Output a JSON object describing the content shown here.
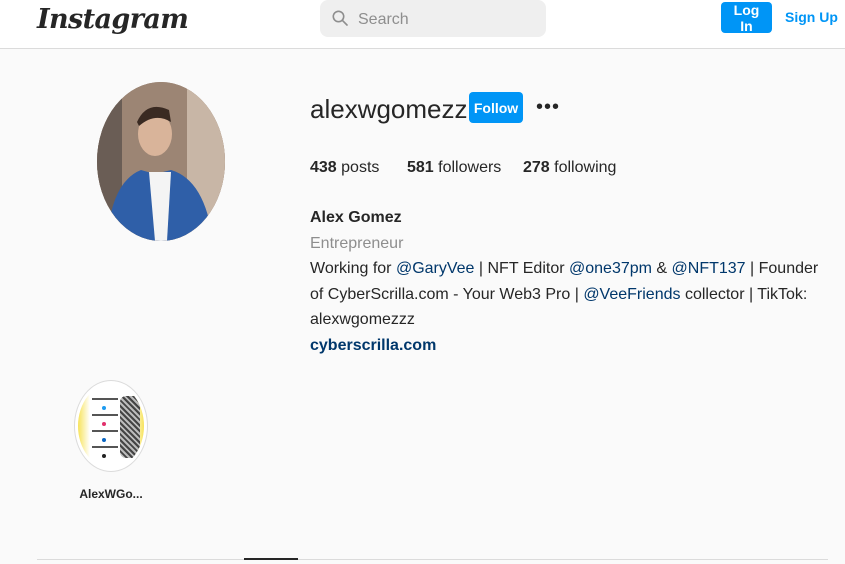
{
  "nav": {
    "logo": "Instagram",
    "search_placeholder": "Search",
    "login_label": "Log In",
    "signup_label": "Sign Up"
  },
  "profile": {
    "username": "alexwgomezz",
    "follow_label": "Follow",
    "more_label": "•••",
    "stats": {
      "posts_count": "438",
      "posts_label": "posts",
      "followers_count": "581",
      "followers_label": "followers",
      "following_count": "278",
      "following_label": "following"
    },
    "full_name": "Alex Gomez",
    "category": "Entrepreneur",
    "bio": {
      "t1": "Working for ",
      "m1": "@GaryVee",
      "t2": " | NFT Editor ",
      "m2": "@one37pm",
      "t3": " & ",
      "m3": "@NFT137",
      "t4": " | Founder of CyberScrilla.com - Your Web3 Pro | ",
      "m4": "@VeeFriends",
      "t5": " collector | TikTok: alexwgomezzz"
    },
    "website": "cyberscrilla.com"
  },
  "highlights": [
    {
      "label": "AlexWGo..."
    }
  ],
  "colors": {
    "accent": "#0095f6",
    "mention": "#00376b",
    "muted": "#8e8e8e",
    "border": "#dbdbdb"
  }
}
